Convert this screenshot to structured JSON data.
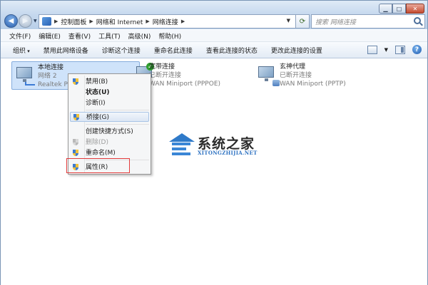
{
  "window": {
    "breadcrumb": [
      "控制面板",
      "网络和 Internet",
      "网络连接"
    ],
    "search_placeholder": "搜索 网络连接",
    "controls": {
      "minimize": "▁",
      "maximize": "□",
      "close": "✕"
    }
  },
  "menubar": [
    "文件(F)",
    "编辑(E)",
    "查看(V)",
    "工具(T)",
    "高级(N)",
    "帮助(H)"
  ],
  "toolbar": {
    "organize": "组织",
    "items": [
      "禁用此网络设备",
      "诊断这个连接",
      "重命名此连接",
      "查看此连接的状态",
      "更改此连接的设置"
    ]
  },
  "connections": [
    {
      "name": "本地连接",
      "status": "网络 2",
      "device": "Realtek PC",
      "icon": "lan-adapter-icon",
      "selected": true
    },
    {
      "name": "宽带连接",
      "status": "已断开连接",
      "device": "WAN Miniport (PPPOE)",
      "icon": "broadband-icon"
    },
    {
      "name": "玄神代理",
      "status": "已断开连接",
      "device": "WAN Miniport (PPTP)",
      "icon": "vpn-icon"
    }
  ],
  "context_menu": [
    {
      "label": "禁用(B)",
      "shield": true
    },
    {
      "label": "状态(U)",
      "bold": true
    },
    {
      "label": "诊断(I)"
    },
    {
      "label": "桥接(G)",
      "shield": true,
      "hover": true
    },
    {
      "label": "创建快捷方式(S)"
    },
    {
      "label": "删除(D)",
      "shield": true,
      "disabled": true
    },
    {
      "label": "重命名(M)",
      "shield": true
    },
    {
      "label": "属性(R)",
      "shield": true,
      "highlighted": true
    }
  ],
  "watermark": {
    "title": "系统之家",
    "subtitle": "XITONGZHIJIA.NET"
  },
  "colors": {
    "selection": "#cfe3fa",
    "highlight_box": "#e23b3b",
    "accent": "#2f7ac9"
  }
}
